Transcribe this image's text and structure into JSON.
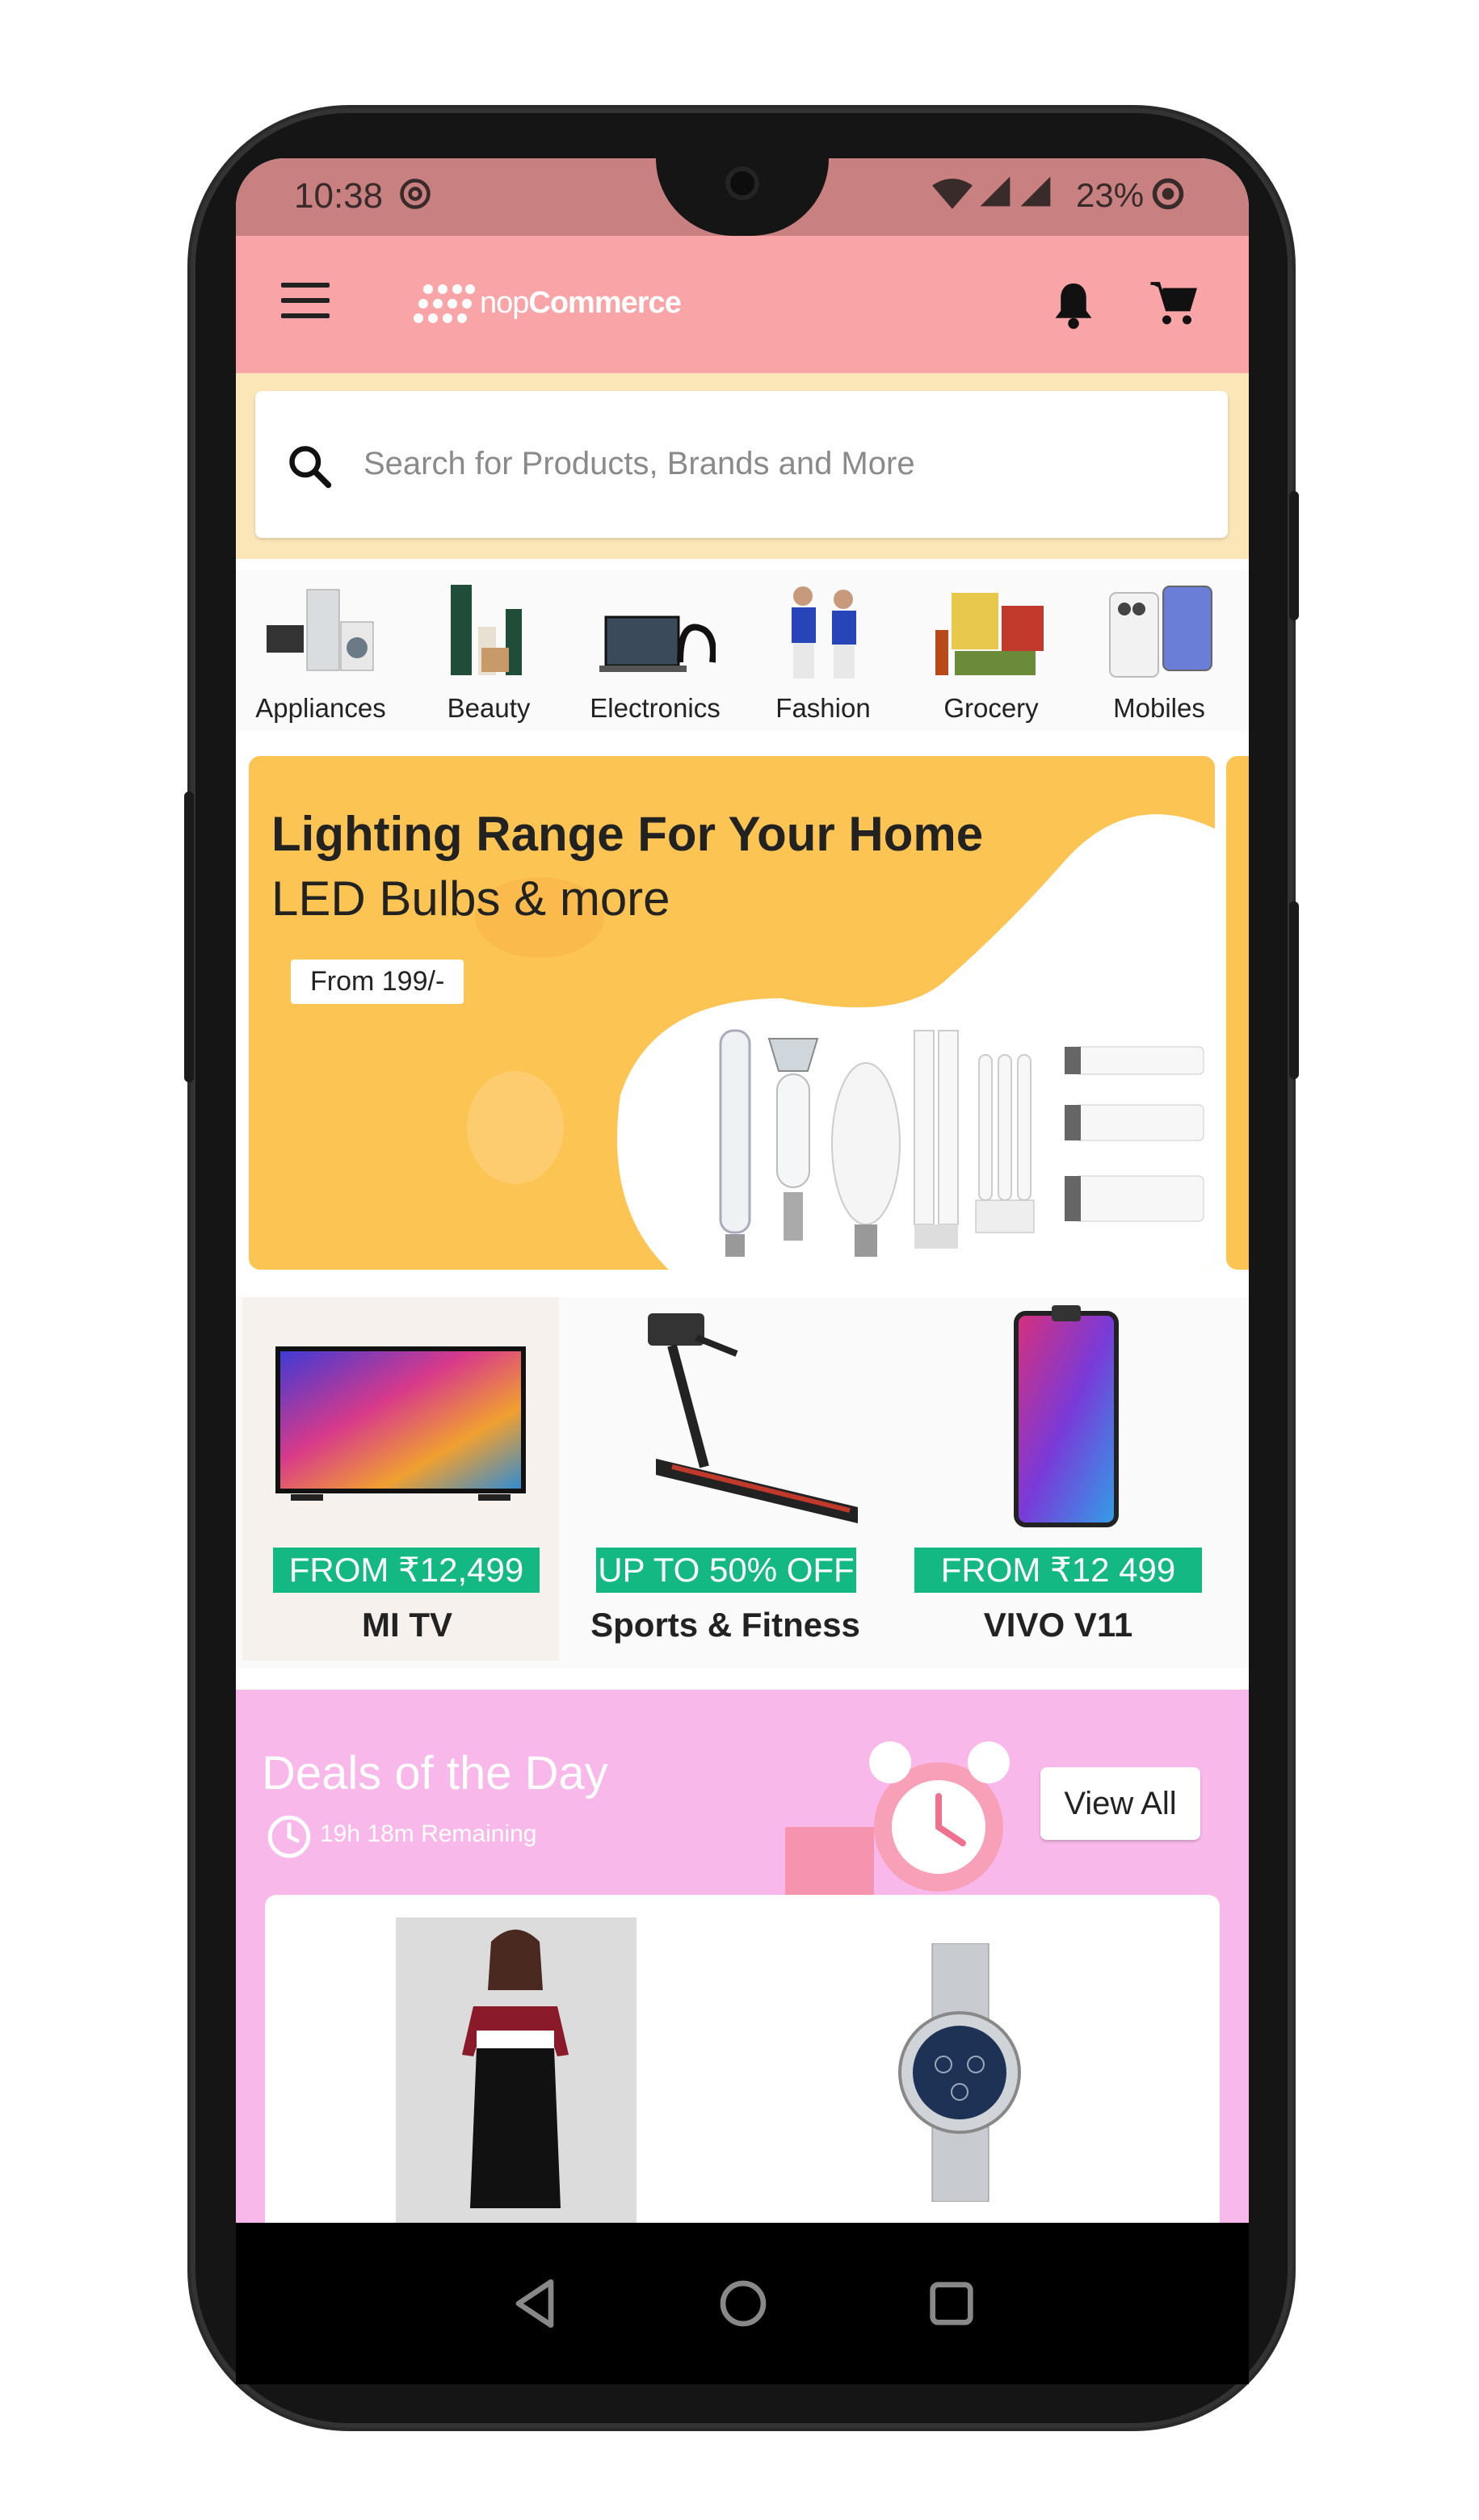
{
  "status_bar": {
    "time": "10:38",
    "battery": "23%",
    "icons": [
      "at-sign-icon",
      "wifi-icon",
      "signal-icon",
      "signal-roaming-icon",
      "battery-ring-icon"
    ]
  },
  "app_bar": {
    "logo_text_light": "nop",
    "logo_text_bold": "Commerce",
    "icons": [
      "menu-icon",
      "notification-bell-icon",
      "cart-icon"
    ],
    "background": "#f9a5a8"
  },
  "search": {
    "placeholder": "Search for Products, Brands and More",
    "background": "#fbe6b8"
  },
  "categories": [
    {
      "label": "Appliances"
    },
    {
      "label": "Beauty"
    },
    {
      "label": "Electronics"
    },
    {
      "label": "Fashion"
    },
    {
      "label": "Grocery"
    },
    {
      "label": "Mobiles"
    }
  ],
  "banner": {
    "title": "Lighting Range For Your Home",
    "subtitle": "LED Bulbs & more",
    "badge": "From 199/-",
    "background": "#fcc452"
  },
  "promos": [
    {
      "tag": "FROM ₹12,499",
      "title": "MI TV"
    },
    {
      "tag": "UP TO 50% OFF",
      "title": "Sports & Fitness"
    },
    {
      "tag": "FROM ₹12 499",
      "title": "VIVO V11"
    }
  ],
  "promo_tag_color": "#13b883",
  "deals": {
    "title": "Deals of the Day",
    "timer": "19h 18m Remaining",
    "view_all": "View All",
    "background": "#f9b8ea"
  },
  "nav_bar": {
    "icons": [
      "back-icon",
      "home-icon",
      "recents-icon"
    ]
  }
}
